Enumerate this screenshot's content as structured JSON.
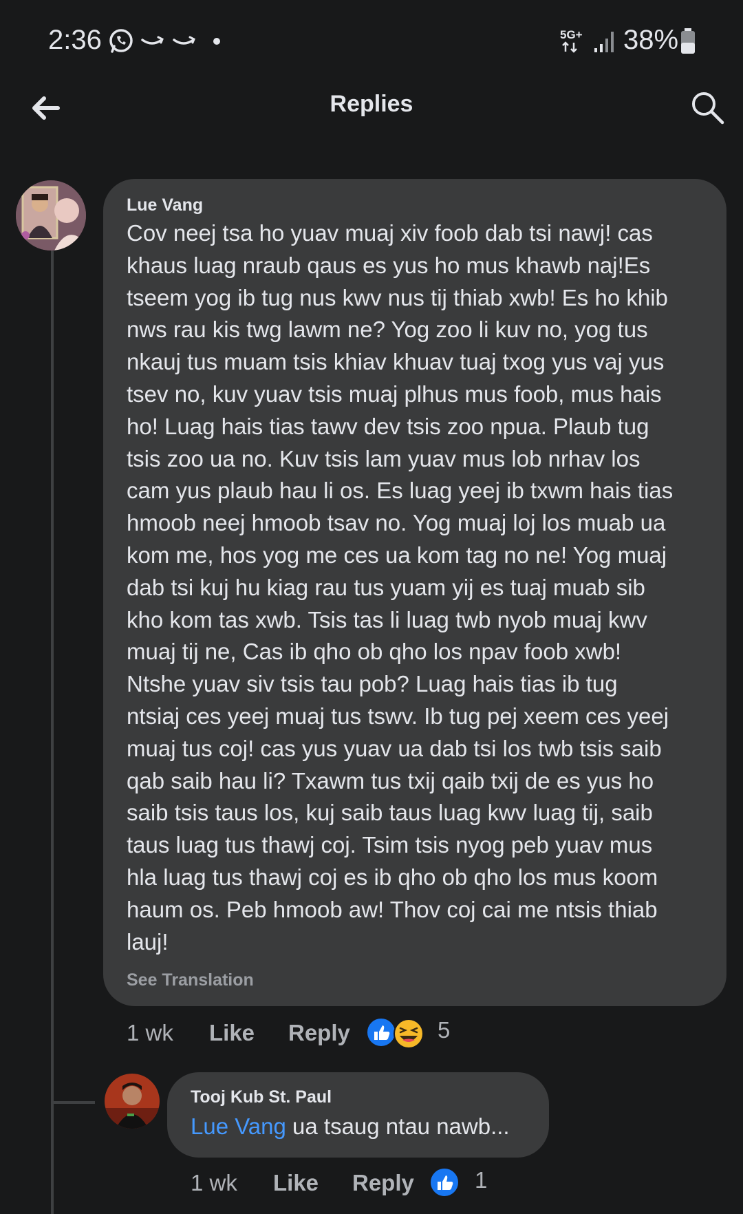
{
  "status_bar": {
    "time": "2:36",
    "network": "5G+",
    "battery": "38%",
    "icons": [
      "whatsapp-icon",
      "amazon-icon",
      "amazon-icon",
      "dot-icon",
      "network-5g-icon",
      "signal-icon",
      "battery-icon"
    ]
  },
  "header": {
    "title": "Replies",
    "back_icon": "arrow-left-icon",
    "search_icon": "search-icon"
  },
  "comment": {
    "author": "Lue Vang",
    "lines": [
      "Cov neej tsa ho yuav muaj xiv foob dab tsi nawj! cas",
      "khaus luag nraub qaus es yus ho mus khawb naj!Es",
      "tseem yog ib tug nus kwv nus tij thiab xwb! Es ho khib",
      "nws rau kis twg lawm ne? Yog zoo li kuv no, yog tus",
      "nkauj tus muam tsis khiav khuav tuaj txog yus vaj yus",
      "tsev no, kuv yuav tsis muaj plhus mus foob, mus hais",
      "ho! Luag hais tias tawv dev tsis zoo npua. Plaub tug",
      "tsis zoo ua no. Kuv tsis lam yuav mus lob nrhav los",
      "cam yus plaub hau li os. Es luag yeej ib txwm hais tias",
      "hmoob neej hmoob tsav no. Yog muaj loj los muab ua",
      "kom me, hos yog me ces ua kom tag no ne! Yog muaj",
      "dab tsi kuj hu kiag rau tus yuam yij es tuaj muab sib",
      "kho kom tas xwb. Tsis tas li luag twb nyob muaj kwv",
      "muaj tij ne, Cas ib qho ob qho los npav foob xwb!",
      "Ntshe yuav siv tsis tau pob? Luag hais tias ib tug",
      "ntsiaj ces yeej muaj tus tswv. Ib tug pej xeem ces yeej",
      "muaj tus coj! cas yus yuav ua dab tsi los twb tsis saib",
      "qab saib hau li? Txawm tus txij qaib txij de es yus ho",
      "saib tsis taus los, kuj saib taus luag kwv luag tij, saib",
      "taus luag tus thawj coj. Tsim tsis nyog peb yuav mus",
      "hla luag tus thawj coj es ib qho ob qho los mus koom",
      "haum os. Peb hmoob aw! Thov coj cai me ntsis thiab",
      "lauj!"
    ],
    "see_translation": "See Translation",
    "time": "1 wk",
    "like": "Like",
    "reply": "Reply",
    "reaction_count": "5",
    "reactions": [
      "like-reaction-icon",
      "haha-reaction-icon"
    ]
  },
  "reply": {
    "author": "Tooj Kub St. Paul",
    "mention": "Lue Vang",
    "text": " ua tsaug ntau nawb...",
    "time": "1 wk",
    "like": "Like",
    "reply": "Reply",
    "reaction_count": "1",
    "reactions": [
      "like-reaction-icon"
    ]
  },
  "colors": {
    "background": "#18191a",
    "bubble": "#3a3b3c",
    "text": "#e4e6eb",
    "muted": "#b0b3b8",
    "mention": "#4599ff",
    "like_blue": "#1877f2",
    "haha_yellow": "#f7b928"
  }
}
